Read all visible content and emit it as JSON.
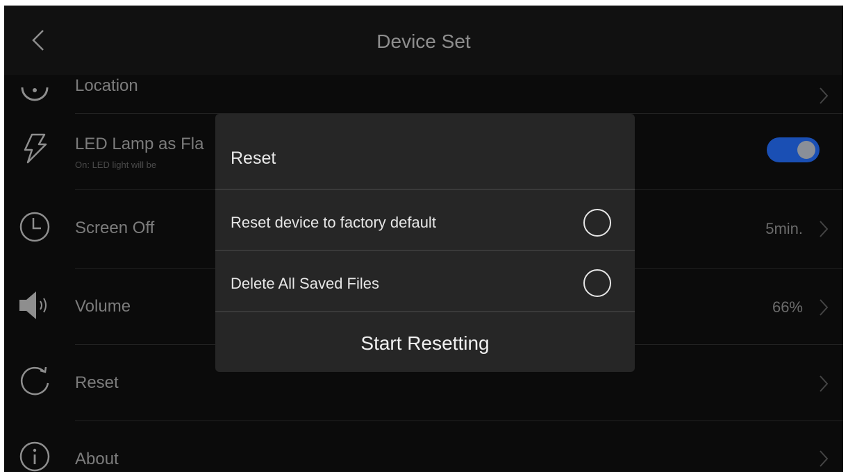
{
  "header": {
    "title": "Device Set"
  },
  "settings": {
    "location": {
      "label": "Location"
    },
    "led_lamp": {
      "label": "LED Lamp as Fla",
      "sub": "On: LED light will be",
      "on": true
    },
    "screen_off": {
      "label": "Screen Off",
      "value": "5min."
    },
    "volume": {
      "label": "Volume",
      "value": "66%"
    },
    "reset": {
      "label": "Reset"
    },
    "about": {
      "label": "About"
    }
  },
  "dialog": {
    "title": "Reset",
    "options": [
      {
        "label": "Reset device to factory default",
        "selected": false
      },
      {
        "label": "Delete All Saved Files",
        "selected": false
      }
    ],
    "action_label": "Start Resetting"
  },
  "colors": {
    "toggle_on": "#1a4fb4",
    "dialog_bg": "#262626",
    "screen_bg": "#0b0b0b"
  }
}
